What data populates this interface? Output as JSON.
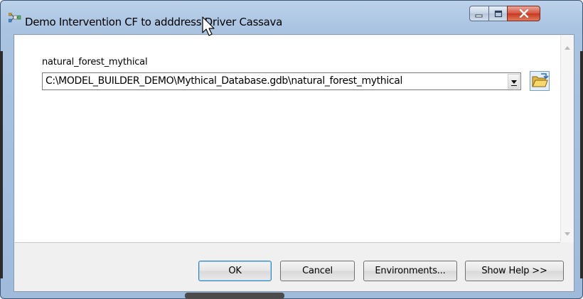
{
  "window": {
    "title": "Demo Intervention CF to adddress Driver Cassava",
    "controls": {
      "minimize": "minimize",
      "maximize": "maximize",
      "close": "close"
    }
  },
  "parameter": {
    "label": "natural_forest_mythical",
    "value": "C:\\MODEL_BUILDER_DEMO\\Mythical_Database.gdb\\natural_forest_mythical"
  },
  "buttons": {
    "ok": "OK",
    "cancel": "Cancel",
    "environments": "Environments...",
    "show_help": "Show Help >>"
  },
  "icons": {
    "app": "model-tool-icon",
    "browse": "open-folder-icon",
    "cursor": "mouse-pointer"
  }
}
